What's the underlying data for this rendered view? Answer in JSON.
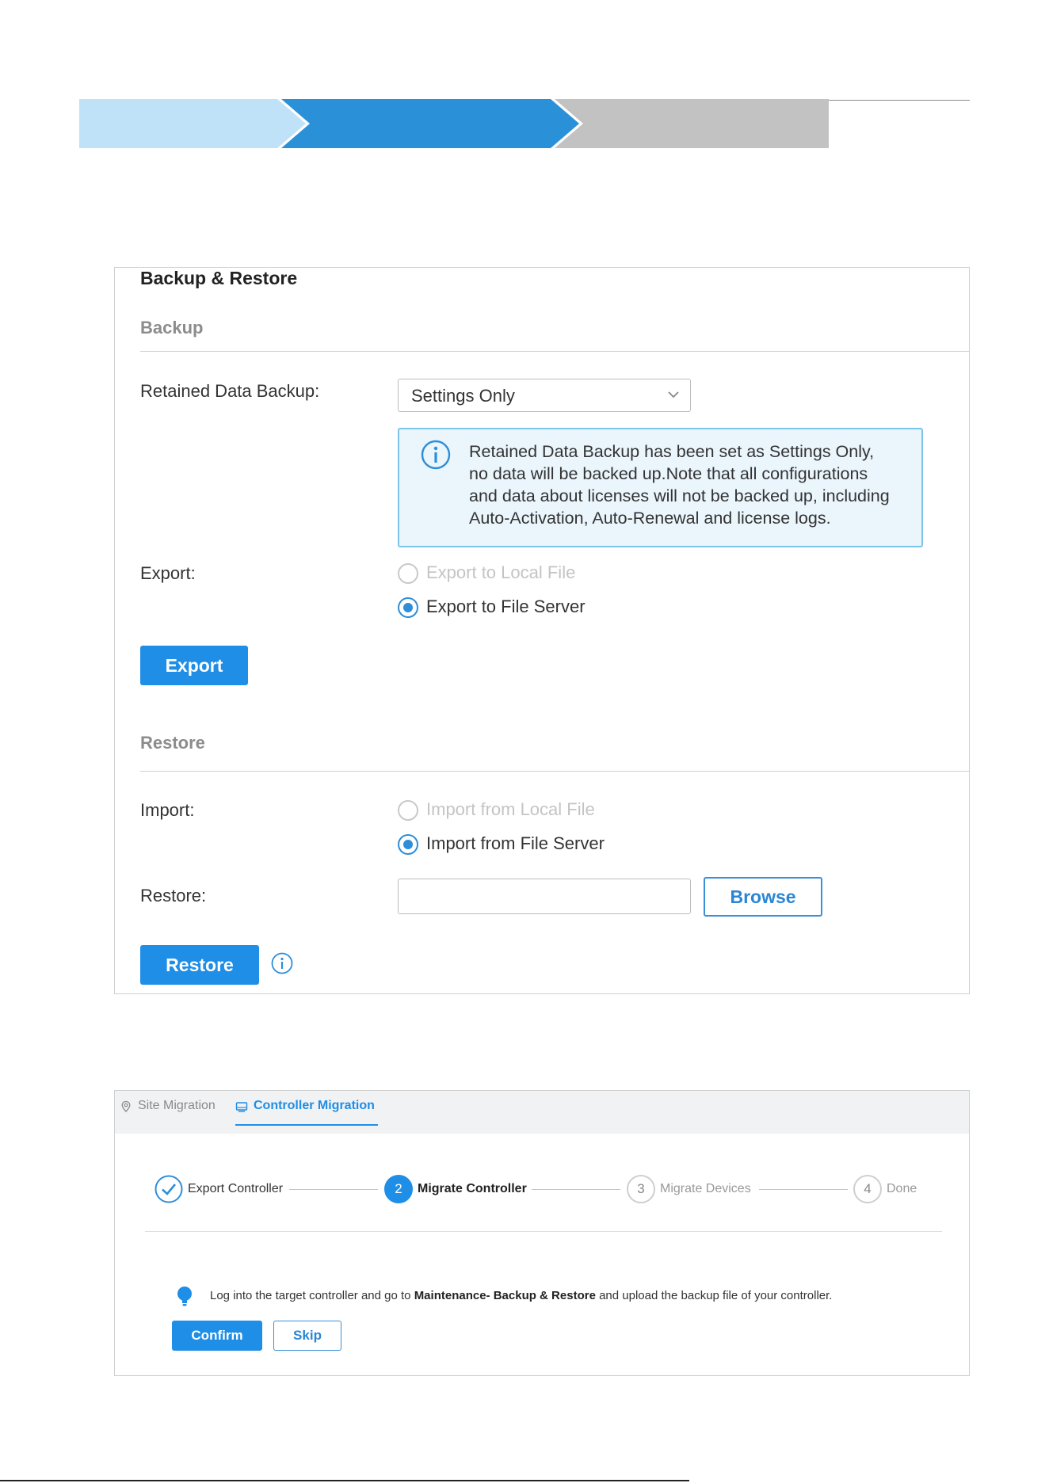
{
  "colors": {
    "chevron_step_done": "#bfe2f8",
    "chevron_step_active": "#2a91d8",
    "chevron_step_pending": "#c2c2c2",
    "primary": "#1f8ee6",
    "info_box_bg": "#eaf5fc",
    "info_box_border": "#7ec4ea"
  },
  "backup_restore": {
    "title": "Backup & Restore",
    "backup_section": "Backup",
    "retained_label": "Retained Data Backup:",
    "retained_value": "Settings Only",
    "info_message_1": "Retained Data Backup has been set as Settings Only,",
    "info_message_2": "no data will be backed up.Note that all configurations",
    "info_message_3": "and data about licenses will not be backed up, including",
    "info_message_4": "Auto-Activation, Auto-Renewal and license logs.",
    "export_label": "Export:",
    "export_local": "Export to Local File",
    "export_server": "Export to File Server",
    "export_selected": "Export to File Server",
    "export_button": "Export",
    "restore_section": "Restore",
    "import_label": "Import:",
    "import_local": "Import from Local File",
    "import_server": "Import from File Server",
    "import_selected": "Import from File Server",
    "restore_label": "Restore:",
    "restore_input_value": "",
    "browse_button": "Browse",
    "restore_button": "Restore"
  },
  "migration": {
    "tabs": [
      {
        "label": "Site Migration",
        "icon": "location-pin-icon",
        "active": false
      },
      {
        "label": "Controller Migration",
        "icon": "controller-icon",
        "active": true
      }
    ],
    "steps": [
      {
        "number": "1",
        "label": "Export Controller",
        "state": "done"
      },
      {
        "number": "2",
        "label": "Migrate Controller",
        "state": "active"
      },
      {
        "number": "3",
        "label": "Migrate Devices",
        "state": "pending"
      },
      {
        "number": "4",
        "label": "Done",
        "state": "pending"
      }
    ],
    "tip_part1": "Log into the target controller and go to",
    "tip_bold": "Maintenance- Backup & Restore",
    "tip_part2": "and upload the backup file of your controller.",
    "confirm_button": "Confirm",
    "skip_button": "Skip"
  }
}
